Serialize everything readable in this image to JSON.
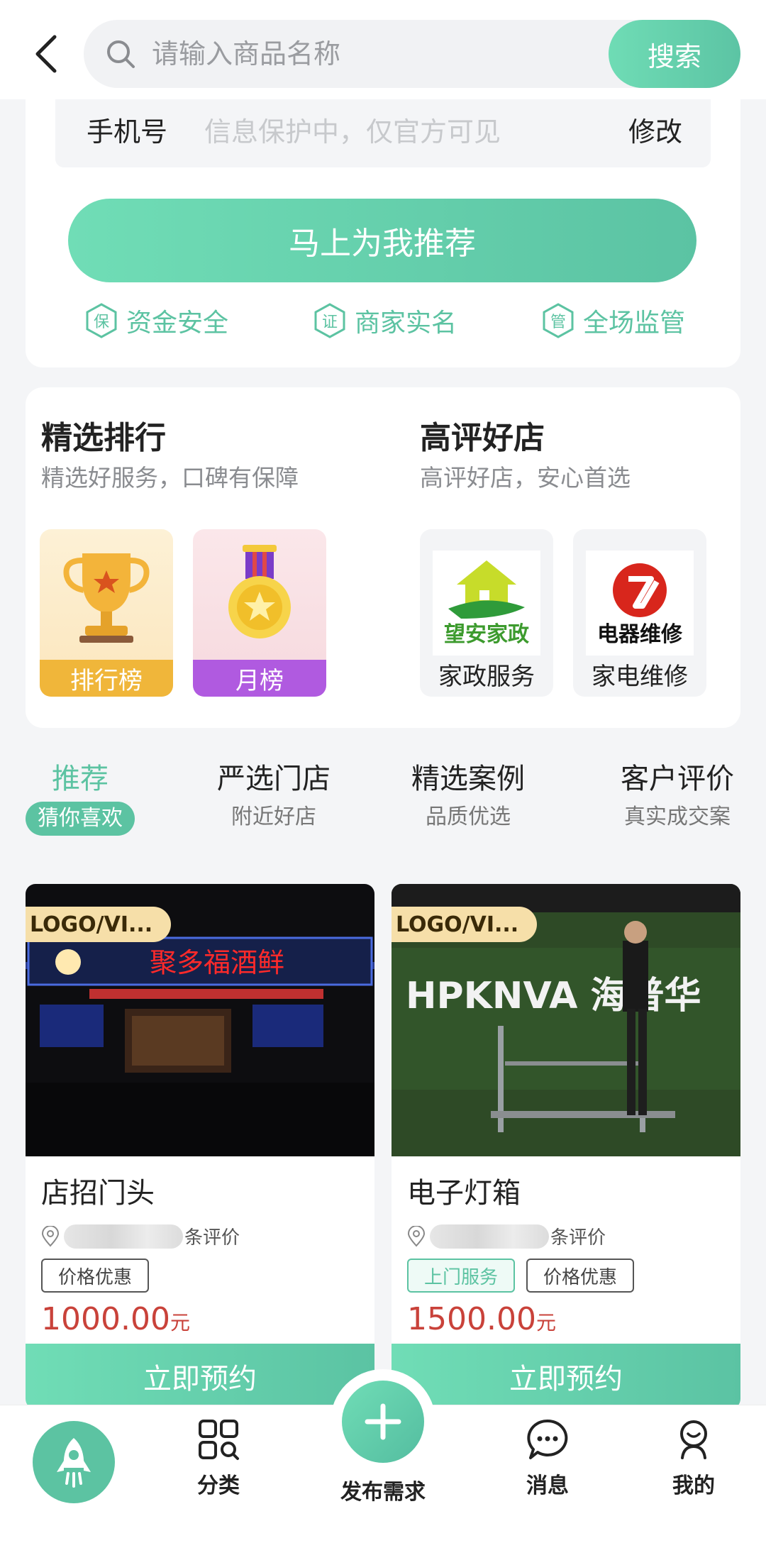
{
  "header": {
    "search_placeholder": "请输入商品名称",
    "search_button": "搜索"
  },
  "form": {
    "phone_label": "手机号",
    "phone_value": "信息保护中，仅官方可见",
    "edit_label": "修改",
    "cta": "马上为我推荐",
    "guarantees": [
      {
        "badge": "保",
        "label": "资金安全"
      },
      {
        "badge": "证",
        "label": "商家实名"
      },
      {
        "badge": "管",
        "label": "全场监管"
      }
    ]
  },
  "ranking": {
    "title": "精选排行",
    "subtitle": "精选好服务，口碑有保障",
    "tiles": [
      {
        "label": "排行榜",
        "color": "#f0b63a"
      },
      {
        "label": "月榜",
        "color": "#b05ae0"
      }
    ]
  },
  "shops": {
    "title": "高评好店",
    "subtitle": "高评好店，安心首选",
    "items": [
      {
        "logo_text": "望安家政",
        "label": "家政服务"
      },
      {
        "logo_text": "电器维修",
        "label": "家电维修"
      }
    ]
  },
  "tabs": [
    {
      "title": "推荐",
      "sub": "猜你喜欢"
    },
    {
      "title": "严选门店",
      "sub": "附近好店"
    },
    {
      "title": "精选案例",
      "sub": "品质优选"
    },
    {
      "title": "客户评价",
      "sub": "真实成交案"
    }
  ],
  "products": [
    {
      "tag": "LOGO/VI...",
      "sign_text": "聚多福酒鲜",
      "name": "店招门头",
      "review_suffix": "条评价",
      "chips": [
        "价格优惠"
      ],
      "price": "1000.00",
      "unit": "元",
      "book": "立即预约"
    },
    {
      "tag": "LOGO/VI...",
      "sign_text": "HPKNVA 海普华",
      "name": "电子灯箱",
      "review_suffix": "条评价",
      "chips": [
        "上门服务",
        "价格优惠"
      ],
      "price": "1500.00",
      "unit": "元",
      "book": "立即预约"
    }
  ],
  "nav": {
    "category": "分类",
    "publish": "发布需求",
    "messages": "消息",
    "mine": "我的"
  },
  "colors": {
    "accent": "#5cc3a2",
    "price": "#c9423a"
  }
}
